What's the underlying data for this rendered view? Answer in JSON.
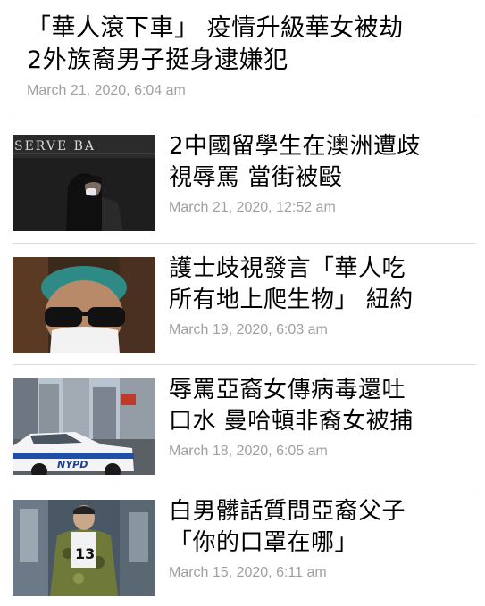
{
  "top_article": {
    "title_lines": [
      "「華人滾下車」 疫情升級華女被劫",
      "2外族裔男子挺身逮嫌犯"
    ],
    "date": "March 21, 2020, 6:04 am"
  },
  "articles": [
    {
      "title_lines": [
        "2中國留學生在澳洲遭歧",
        "視辱罵 當街被毆"
      ],
      "date": "March 21, 2020, 12:52 am",
      "thumb_caption": "SERVE    BA"
    },
    {
      "title_lines": [
        "護士歧視發言「華人吃",
        "所有地上爬生物」 紐約"
      ],
      "date": "March 19, 2020, 6:03 am"
    },
    {
      "title_lines": [
        "辱罵亞裔女傳病毒還吐",
        "口水 曼哈頓非裔女被捕"
      ],
      "date": "March 18, 2020, 6:05 am",
      "thumb_caption": "NYPD"
    },
    {
      "title_lines": [
        "白男髒話質問亞裔父子",
        "「你的口罩在哪」"
      ],
      "date": "March 15, 2020, 6:11 am",
      "thumb_caption": "13"
    }
  ]
}
